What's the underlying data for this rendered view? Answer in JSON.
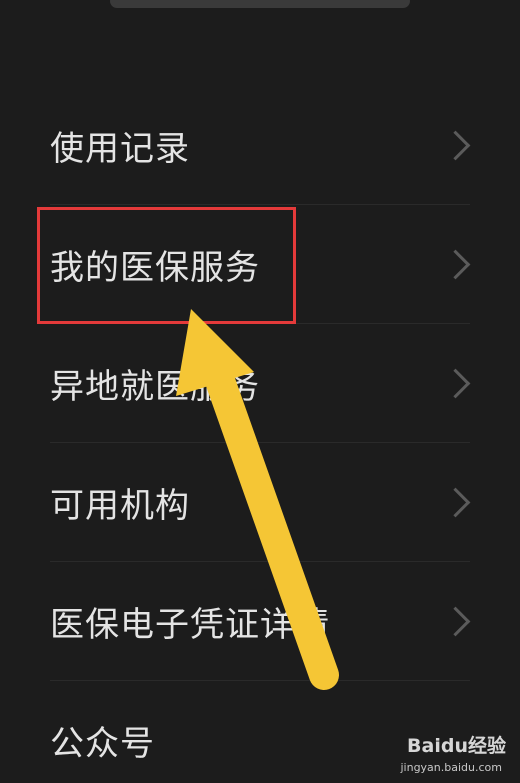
{
  "menu": {
    "items": [
      {
        "label": "使用记录"
      },
      {
        "label": "我的医保服务"
      },
      {
        "label": "异地就医服务"
      },
      {
        "label": "可用机构"
      },
      {
        "label": "医保电子凭证详情"
      },
      {
        "label": "公众号"
      }
    ]
  },
  "annotation": {
    "highlight_color": "#e43a3a",
    "arrow_color": "#f5c635",
    "highlighted_item": "我的医保服务"
  },
  "watermark": {
    "brand": "Baidu经验",
    "url": "jingyan.baidu.com"
  },
  "colors": {
    "background": "#1c1c1c",
    "text": "#e4e4e4",
    "chevron": "#5b5b5b"
  },
  "icons": {
    "row_chevron": "chevron-right-icon",
    "annotation": "arrow-up-icon"
  }
}
